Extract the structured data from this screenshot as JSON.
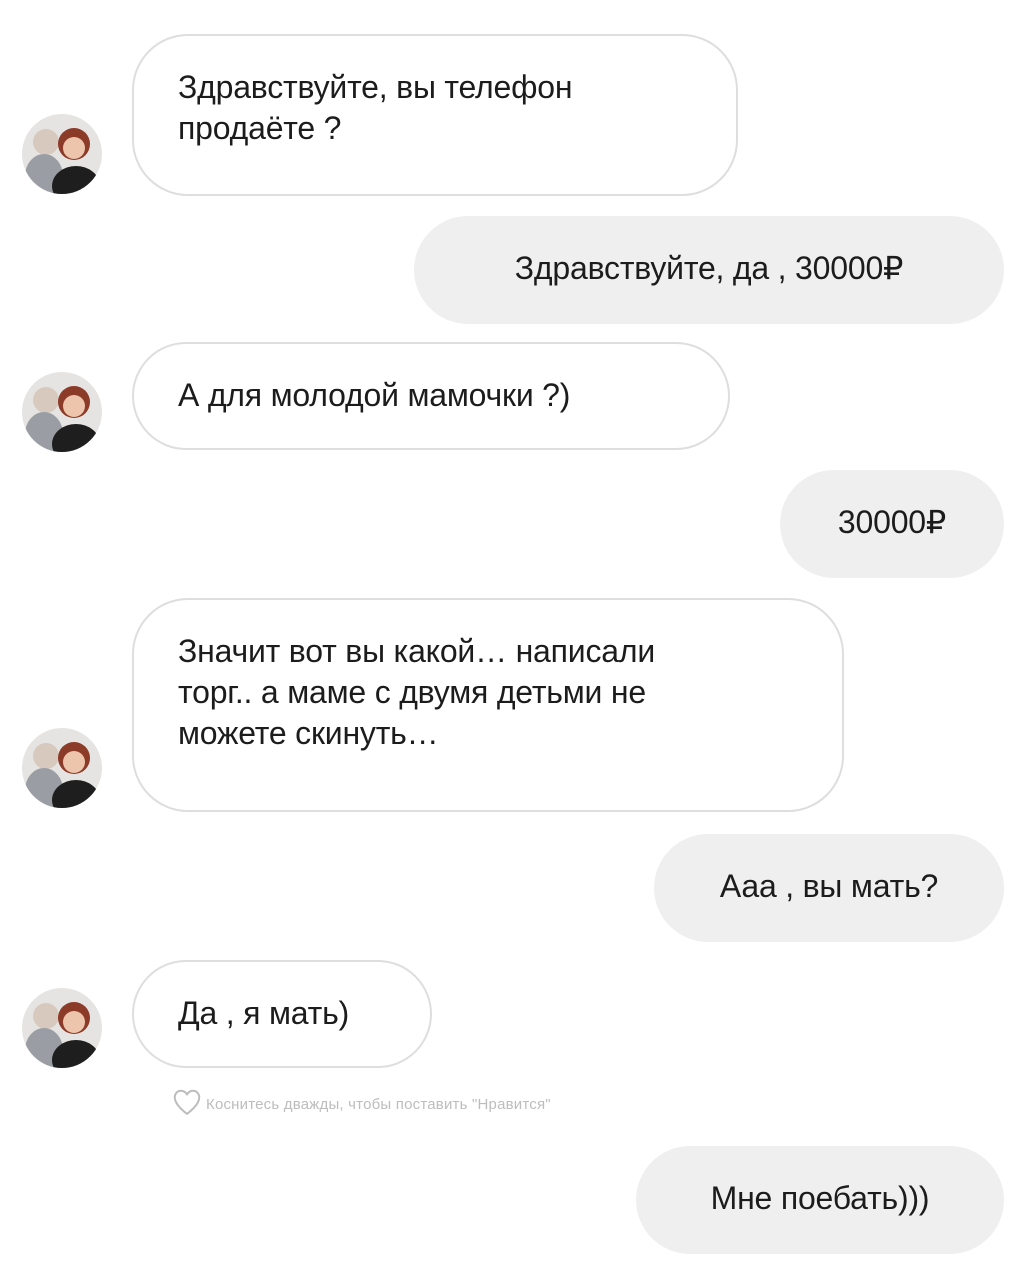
{
  "messages": [
    {
      "id": "m1",
      "side": "incoming",
      "text": "Здравствуйте, вы телефон\nпродаёте ?"
    },
    {
      "id": "m2",
      "side": "outgoing",
      "text": "Здравствуйте, да , 30000₽"
    },
    {
      "id": "m3",
      "side": "incoming",
      "text": "А для молодой мамочки ?)"
    },
    {
      "id": "m4",
      "side": "outgoing",
      "text": "30000₽"
    },
    {
      "id": "m5",
      "side": "incoming",
      "text": "Значит вот вы какой… написали\nторг.. а маме с двумя детьми не\nможете скинуть…"
    },
    {
      "id": "m6",
      "side": "outgoing",
      "text": "Ааа , вы мать?"
    },
    {
      "id": "m7",
      "side": "incoming",
      "text": "Да , я мать)"
    },
    {
      "id": "m8",
      "side": "outgoing",
      "text": "Мне поебать)))"
    }
  ],
  "like_hint": {
    "icon": "heart-outline-icon",
    "text": "Коснитесь дважды, чтобы поставить \"Нравится\""
  },
  "colors": {
    "background": "#ffffff",
    "incoming_bubble": "#ffffff",
    "incoming_border": "#dedede",
    "outgoing_bubble": "#efefef",
    "text": "#1c1c1c",
    "hint_text": "#bdbdbd"
  }
}
